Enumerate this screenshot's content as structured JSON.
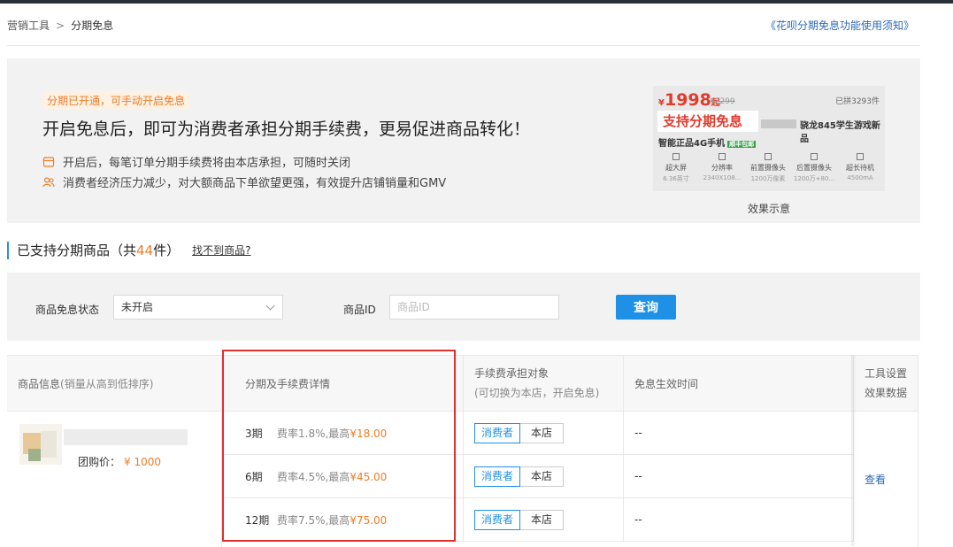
{
  "breadcrumb": {
    "parent": "营销工具",
    "separator": ">",
    "current": "分期免息"
  },
  "help_link": "《花呗分期免息功能使用须知》",
  "banner": {
    "badge": "分期已开通，可手动开启免息",
    "headline": "开启免息后，即可为消费者承担分期手续费，更易促进商品转化！",
    "points": [
      {
        "icon": "shop-icon",
        "text": "开启后，每笔订单分期手续费将由本店承担，可随时关闭"
      },
      {
        "icon": "users-icon",
        "text": "消费者经济压力减少，对大额商品下单欲望更强，有效提升店铺销量和GMV"
      }
    ],
    "preview": {
      "currency": "¥",
      "price": "1998",
      "price_suffix": "起",
      "old_price": "¥2299",
      "sold": "已拼3293件",
      "tag": "支持分期免息",
      "title_frag": "骁龙845学生游戏新品",
      "subtitle": "智能正品4G手机",
      "subtitle_badge": "顺丰包邮",
      "specs": [
        {
          "name": "超大屏",
          "value": "6.36英寸"
        },
        {
          "name": "分辨率",
          "value": "2340X108..."
        },
        {
          "name": "前置摄像头",
          "value": "1200万像素"
        },
        {
          "name": "后置摄像头",
          "value": "1200万+80..."
        },
        {
          "name": "超长待机",
          "value": "4500mA"
        }
      ],
      "caption": "效果示意"
    }
  },
  "section": {
    "title_prefix": "已支持分期商品（共",
    "count": "44",
    "title_suffix": "件）",
    "not_found": "找不到商品?"
  },
  "filter": {
    "status_label": "商品免息状态",
    "status_value": "未开启",
    "id_label": "商品ID",
    "id_placeholder": "商品ID",
    "query_button": "查询"
  },
  "table": {
    "headers": {
      "product": "商品信息",
      "product_note": "(销量从高到低排序)",
      "installment": "分期及手续费详情",
      "payer_line1": "手续费承担对象",
      "payer_line2": "(可切换为本店，开启免息)",
      "effective": "免息生效时间",
      "tools_line1": "工具设置",
      "tools_line2": "效果数据"
    },
    "product": {
      "group_price_label": "团购价：",
      "group_price": "¥ 1000"
    },
    "rows": [
      {
        "period": "3期",
        "rate": "费率1.8%,最高",
        "max": "¥18.00",
        "payer_on": "消费者",
        "payer_off": "本店",
        "time": "--"
      },
      {
        "period": "6期",
        "rate": "费率4.5%,最高",
        "max": "¥45.00",
        "payer_on": "消费者",
        "payer_off": "本店",
        "time": "--"
      },
      {
        "period": "12期",
        "rate": "费率7.5%,最高",
        "max": "¥75.00",
        "payer_on": "消费者",
        "payer_off": "本店",
        "time": "--"
      }
    ],
    "view_link": "查看"
  },
  "colors": {
    "accent": "#1e90e6",
    "orange": "#ee7d2a",
    "highlight_box": "#e03030"
  }
}
